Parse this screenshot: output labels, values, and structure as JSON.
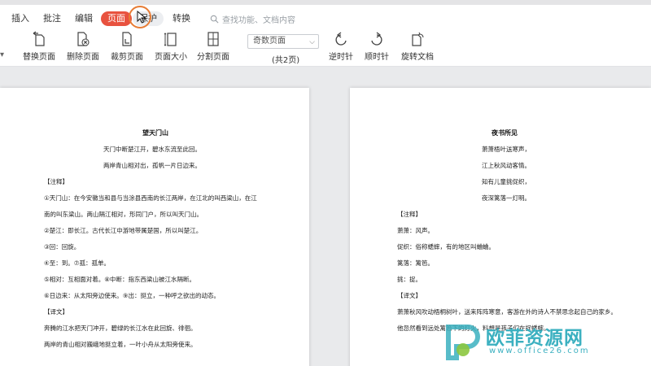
{
  "menu": {
    "tabs": [
      {
        "label": "插入"
      },
      {
        "label": "批注"
      },
      {
        "label": "编辑"
      },
      {
        "label": "页面"
      },
      {
        "label": "保护"
      },
      {
        "label": "转换"
      }
    ],
    "search_placeholder": "查找功能、文档内容"
  },
  "ribbon": {
    "left_fragment": "▾",
    "tools": [
      {
        "label": "替换页面"
      },
      {
        "label": "删除页面"
      },
      {
        "label": "裁剪页面"
      },
      {
        "label": "页面大小"
      },
      {
        "label": "分割页面"
      },
      {
        "label": "逆时针"
      },
      {
        "label": "顺时针"
      },
      {
        "label": "旋转文档"
      }
    ],
    "page_select": "奇数页面",
    "page_count": "(共2页)"
  },
  "doc_left": {
    "title": "望天门山",
    "lines": [
      "天门中断楚江开，碧水东流至此回。",
      "两岸青山相对出，孤帆一片日边来。",
      "【注释】",
      "①天门山：在今安徽当和县与当涂县西南的长江两岸，在江北的叫西梁山，在江",
      "南的叫东梁山。两山隔江相对，形同门户，所以叫天门山。",
      "②楚江：即长江。古代长江中游地带属楚国，所以叫楚江。",
      "③回：回旋。",
      "④至：到。⑦孤：孤单。",
      "⑤相对：互相面对着。⑧中断：指东西梁山被江水隔断。",
      "⑥日边来：从太阳旁边使来。⑨出：挺立，一种呼之欲出的动态。",
      "【译文】",
      "奔腾的江水把天门冲开，碧绿的长江水在此回旋、徘徊。",
      "两岸的青山相对巍峨地挺立着，一叶小舟从太阳旁使来。"
    ]
  },
  "doc_right": {
    "title": "夜书所见",
    "lines": [
      "萧萧梧叶送寒声，",
      "江上秋风动客情。",
      "知有儿童挑促织，",
      "夜深篱落一灯明。",
      "【注释】",
      "萧萧：风声。",
      "促织：俗称蟋蟀，有的地区叫蛐蛐。",
      "篱落：篱笆。",
      "挑：捉。",
      "【译文】",
      "萧萧秋风吹动梧桐树叶，送来阵阵寒意，客游在外的诗人不禁思念起自己的家乡。",
      "他忽然看到远处篱笆下的灯火，料想是孩子们在捉蟋蟀。"
    ]
  },
  "watermark": {
    "main": "欧菲资源网",
    "sub": "www.office26.com"
  },
  "colors": {
    "active_tab": "#e8523f",
    "cursor_ring": "#e77c35",
    "watermark": "#3bb0c0"
  }
}
